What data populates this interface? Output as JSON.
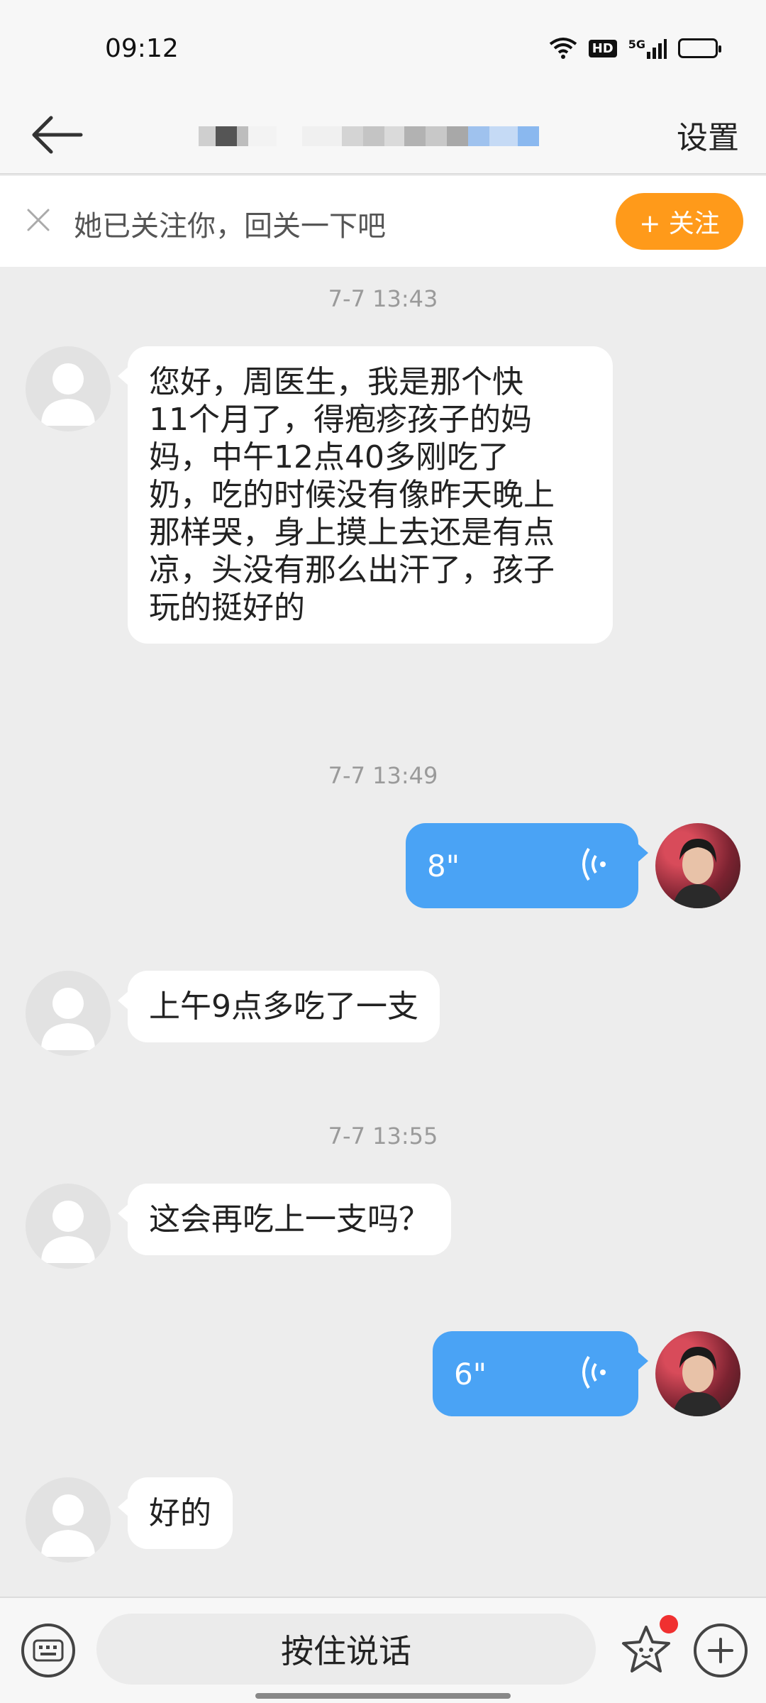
{
  "status_bar": {
    "time": "09:12",
    "hd_label": "HD",
    "network_label": "5G"
  },
  "nav": {
    "settings_label": "设置"
  },
  "banner": {
    "text": "她已关注你，回关一下吧",
    "follow_label": "+ 关注"
  },
  "messages": [
    {
      "type": "timestamp",
      "text": "7-7 13:43"
    },
    {
      "type": "incoming_text",
      "lines": [
        "您好，周医生，我是那个快",
        "11个月了，得疱疹孩子的妈",
        "妈，中午12点40多刚吃了",
        "奶，吃的时候没有像昨天晚上",
        "那样哭，身上摸上去还是有点",
        "凉，头没有那么出汗了，孩子",
        "玩的挺好的"
      ]
    },
    {
      "type": "timestamp",
      "text": "7-7 13:49"
    },
    {
      "type": "outgoing_voice",
      "duration": "8\""
    },
    {
      "type": "incoming_text",
      "text": "上午9点多吃了一支"
    },
    {
      "type": "timestamp",
      "text": "7-7 13:55"
    },
    {
      "type": "incoming_text",
      "text": "这会再吃上一支吗？"
    },
    {
      "type": "outgoing_voice",
      "duration": "6\""
    },
    {
      "type": "incoming_text",
      "text": "好的"
    }
  ],
  "input_bar": {
    "push_to_talk_label": "按住说话"
  },
  "colors": {
    "accent_orange": "#ff9a1a",
    "voice_blue": "#4aa3f5",
    "background": "#ededed",
    "notification_red": "#f03030"
  }
}
